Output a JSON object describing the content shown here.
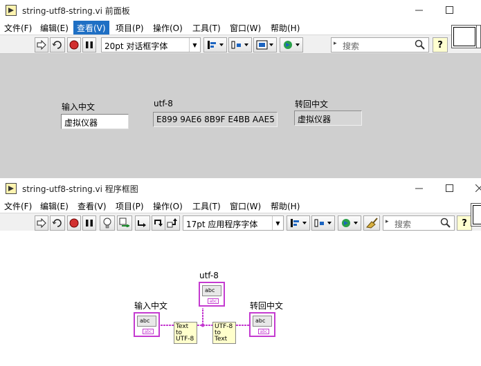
{
  "front_panel": {
    "title": "string-utf8-string.vi 前面板",
    "menu": [
      "文件(F)",
      "编辑(E)",
      "查看(V)",
      "项目(P)",
      "操作(O)",
      "工具(T)",
      "窗口(W)",
      "帮助(H)"
    ],
    "active_menu": "查看(V)",
    "font": "20pt 对话框字体",
    "search_placeholder": "搜索",
    "controls": {
      "input_label": "输入中文",
      "input_value": "虚拟仪器",
      "utf8_label": "utf-8",
      "utf8_value": "E899 9AE6 8B9F E4BB AAE5",
      "output_label": "转回中文",
      "output_value": "虚拟仪器"
    }
  },
  "block_diagram": {
    "title": "string-utf8-string.vi 程序框图",
    "menu": [
      "文件(F)",
      "编辑(E)",
      "查看(V)",
      "项目(P)",
      "操作(O)",
      "工具(T)",
      "窗口(W)",
      "帮助(H)"
    ],
    "font": "17pt 应用程序字体",
    "search_placeholder": "搜索",
    "nodes": {
      "input_label": "输入中文",
      "utf8_label": "utf-8",
      "output_label": "转回中文",
      "text_to_utf8": [
        "Text",
        "to",
        "UTF-8"
      ],
      "utf8_to_text": [
        "UTF-8",
        "to",
        "Text"
      ],
      "terminal_text": "abc"
    }
  },
  "colors": {
    "string_wire": "#c43ad0",
    "panel_bg": "#cfcfcf",
    "active_menu_bg": "#1e6fc4"
  }
}
